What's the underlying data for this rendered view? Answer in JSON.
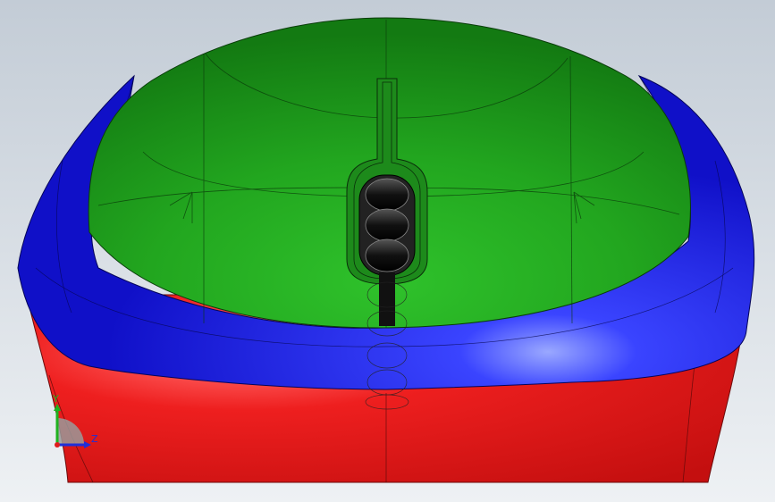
{
  "viewport": {
    "background_top": "#c3ccd6",
    "background_bottom": "#eef1f4"
  },
  "model": {
    "parts": [
      {
        "name": "top-shell",
        "color": "#22a61f"
      },
      {
        "name": "side-trim",
        "color": "#1a20e8"
      },
      {
        "name": "base",
        "color": "#ee1f1f"
      },
      {
        "name": "scroll-wheel",
        "color": "#1a1a1a"
      }
    ]
  },
  "triad": {
    "y_label": "Y",
    "z_label": "Z",
    "y_color": "#1fb21f",
    "z_color": "#1f2fd8",
    "x_color": "#e01c1c"
  }
}
